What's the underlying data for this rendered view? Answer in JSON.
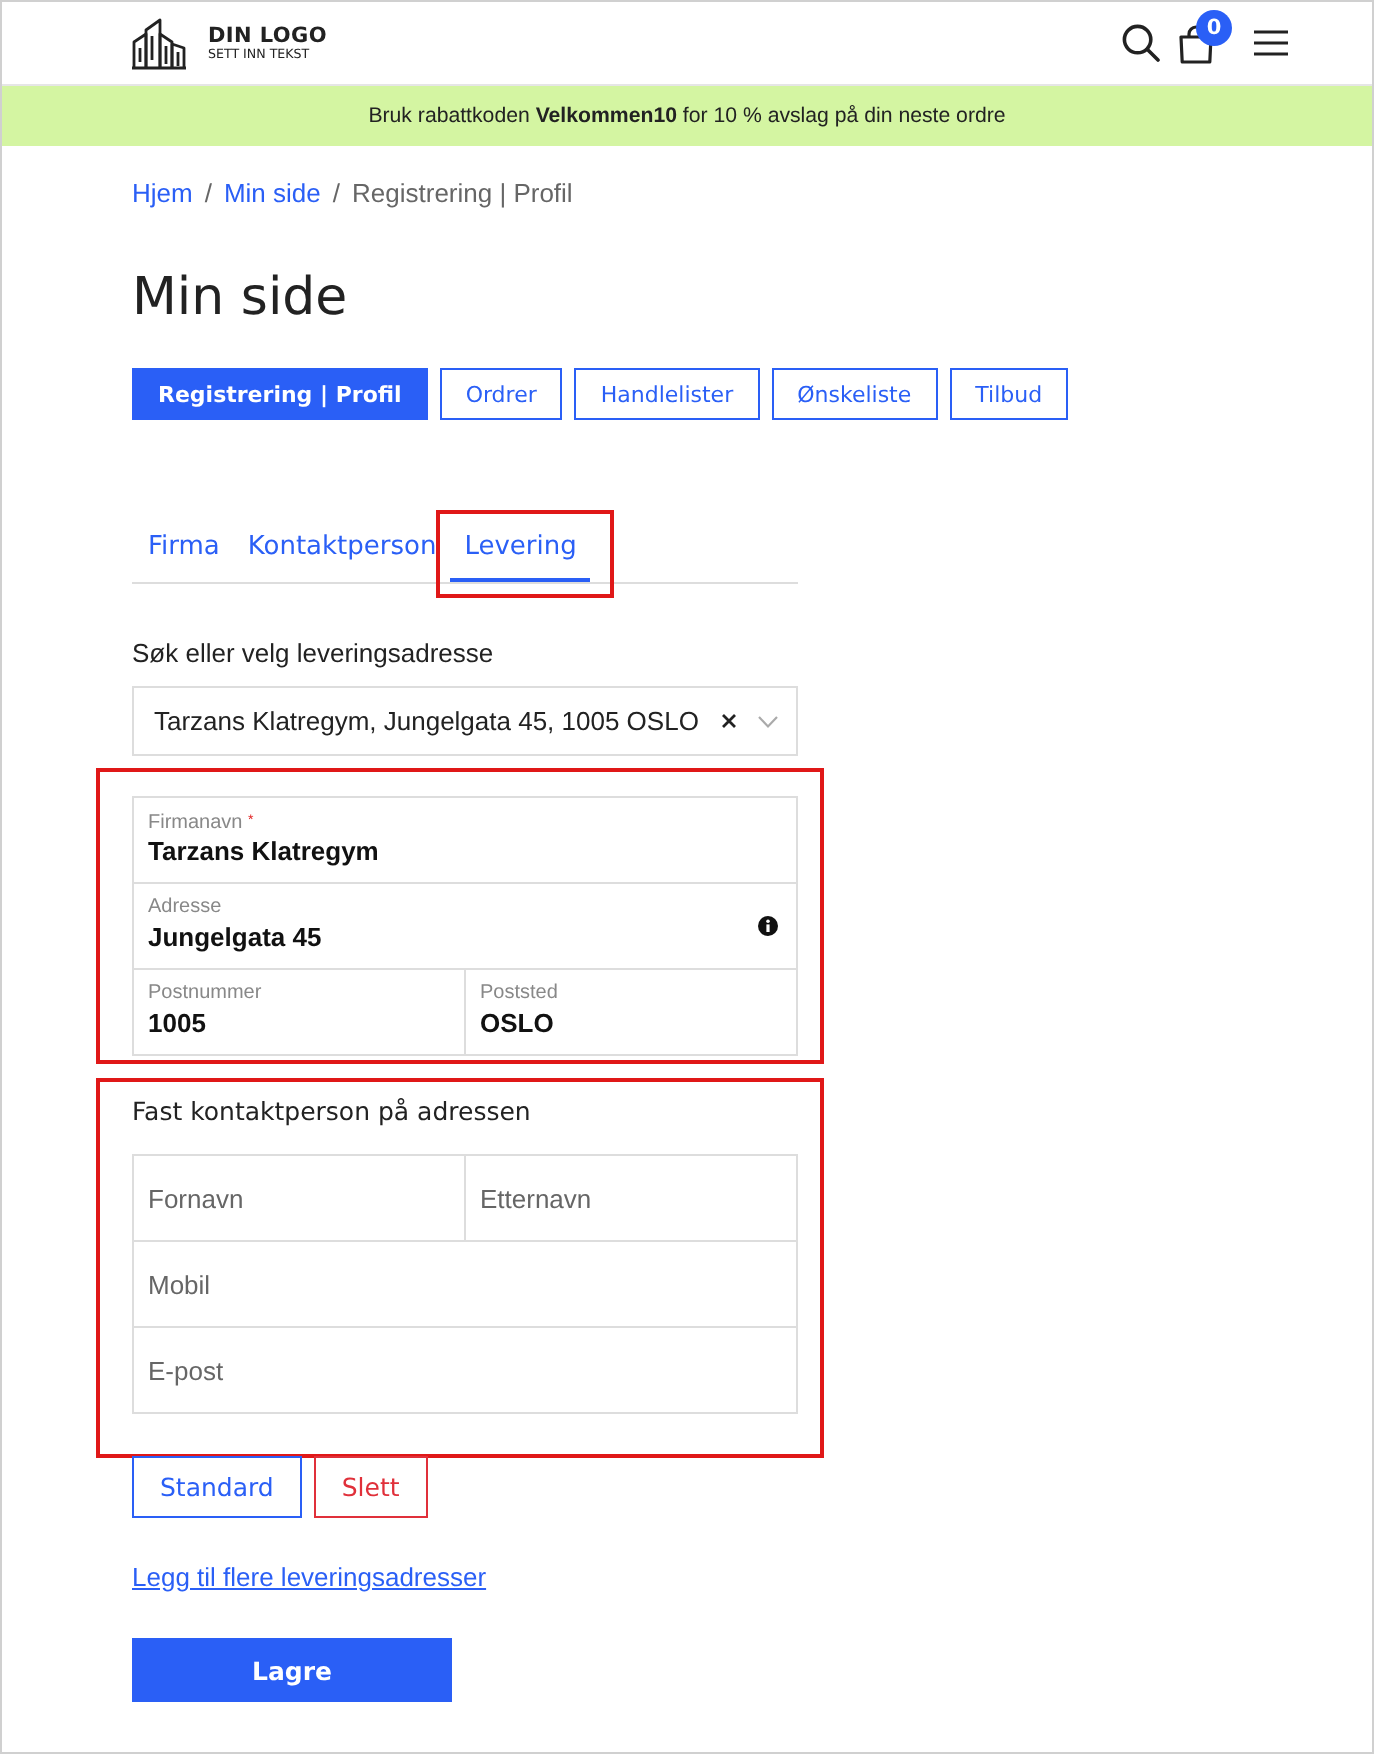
{
  "header": {
    "logo": {
      "title": "DIN LOGO",
      "subtitle": "SETT INN TEKST"
    },
    "cart_count": "0"
  },
  "promo_bar": {
    "text": "Bruk rabattkoden **Velkommen10** for 10 % avslag på din neste ordre"
  },
  "breadcrumb": [
    {
      "label": "Hjem",
      "kind": "link"
    },
    {
      "label": "/",
      "kind": "separator"
    },
    {
      "label": "Min side",
      "kind": "link"
    },
    {
      "label": "/",
      "kind": "separator"
    },
    {
      "label": "Registrering | Profil",
      "kind": "current"
    }
  ],
  "page_title": "Min side",
  "account_nav": [
    {
      "label": "Registrering | Profil",
      "selected": true
    },
    {
      "label": "Ordrer",
      "selected": false
    },
    {
      "label": "Handlelister",
      "selected": false
    },
    {
      "label": "Ønskeliste",
      "selected": false
    },
    {
      "label": "Tilbud",
      "selected": false
    }
  ],
  "tabs": [
    {
      "label": "Firma",
      "selected": false,
      "highlighted": false
    },
    {
      "label": "Kontaktperson",
      "selected": false,
      "highlighted": false
    },
    {
      "label": "Levering",
      "selected": true,
      "highlighted": true
    }
  ],
  "address_picker": {
    "label": "Søk eller velg leveringsadresse",
    "value": "Tarzans Klatregym, Jungelgata 45, 1005 OSLO"
  },
  "address_fields": {
    "highlighted": true,
    "rows": [
      [
        {
          "label": "Firmanavn $^{*}$",
          "value": "Tarzans Klatregym",
          "info": false
        }
      ],
      [
        {
          "label": "Adresse",
          "value": "Jungelgata 45",
          "info": true
        }
      ],
      [
        {
          "label": "Postnummer",
          "value": "1005",
          "info": false
        },
        {
          "label": "Poststed",
          "value": "OSLO",
          "info": false
        }
      ]
    ]
  },
  "contact_section": {
    "title": "Fast kontaktperson på adressen",
    "highlighted": true,
    "rows": [
      [
        {
          "placeholder": "Fornavn"
        },
        {
          "placeholder": "Etternavn"
        }
      ],
      [
        {
          "placeholder": "Mobil"
        }
      ],
      [
        {
          "placeholder": "E-post"
        }
      ]
    ]
  },
  "address_actions": [
    {
      "label": "Standard",
      "kind": "primary"
    },
    {
      "label": "Slett",
      "kind": "danger"
    }
  ],
  "add_link": "Legg til flere leveringsadresser",
  "save_button": "Lagre"
}
